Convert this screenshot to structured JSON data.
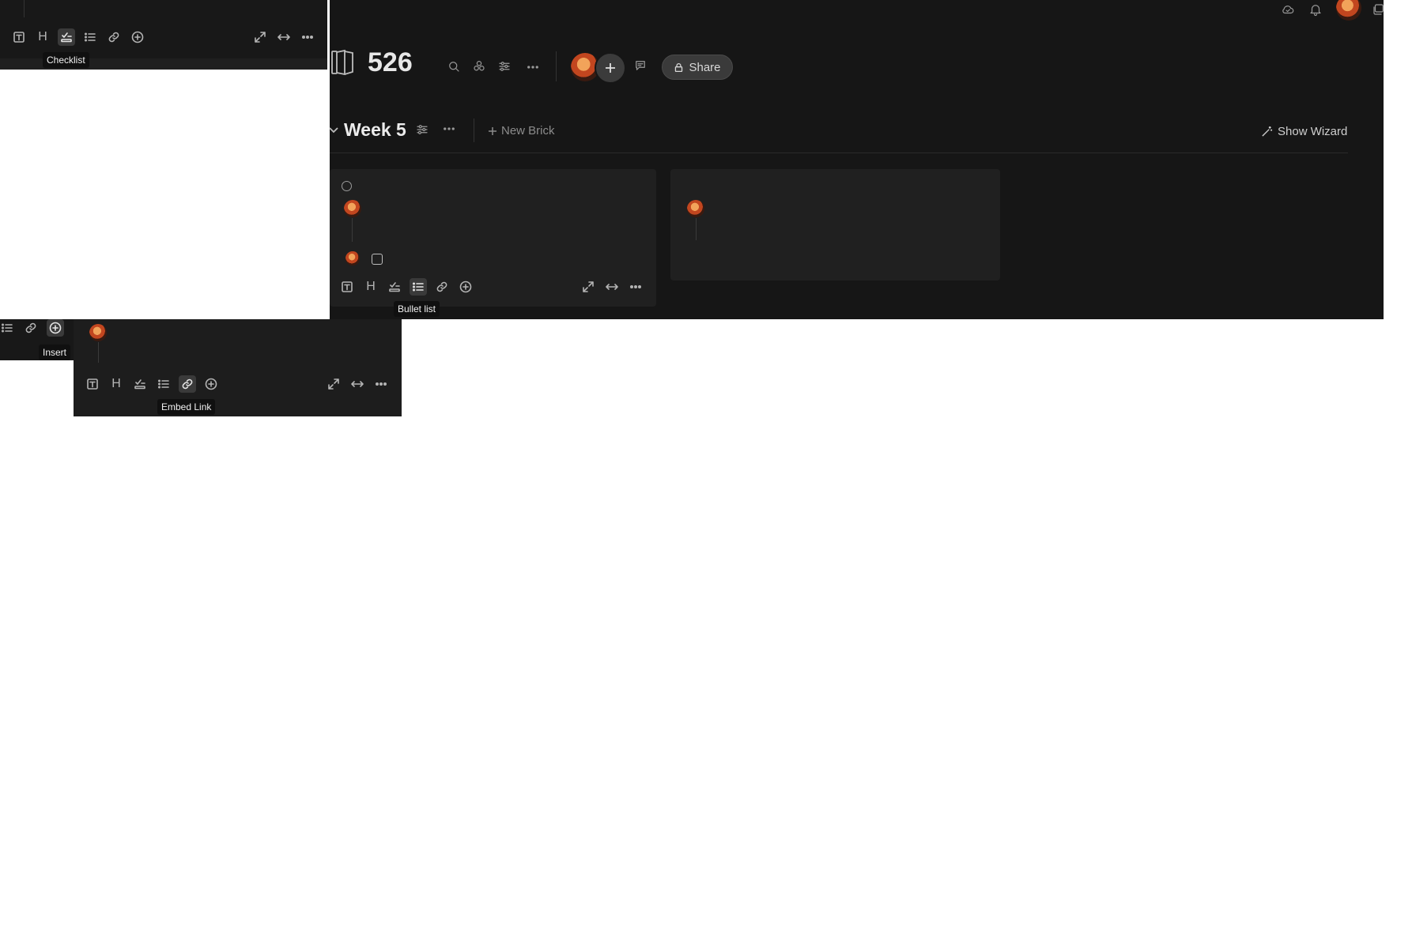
{
  "board": {
    "title": "526",
    "share_label": "Share"
  },
  "section": {
    "title": "Week 5",
    "new_brick_label": "New Brick",
    "show_wizard_label": "Show Wizard"
  },
  "toolbar": {
    "text": "T",
    "heading": "H"
  },
  "tooltips": {
    "checklist": "Checklist",
    "bullet_list": "Bullet list",
    "insert": "Insert",
    "embed_link": "Embed Link"
  },
  "icons": [
    "cloud-icon",
    "bell-icon",
    "avatar",
    "windows-icon",
    "board-icon",
    "search-icon",
    "apps-icon",
    "sliders-icon",
    "more-icon",
    "add-member-icon",
    "comments-icon",
    "lock-icon",
    "chevron-down-icon",
    "plus-icon",
    "wand-icon",
    "text-icon",
    "heading-icon",
    "checklist-icon",
    "bullet-list-icon",
    "link-icon",
    "insert-icon",
    "expand-icon",
    "width-icon"
  ],
  "colors": {
    "background": "#161616",
    "panel": "#1d1d1d",
    "card": "#202020",
    "text": "#e8e8e8",
    "muted": "#9a9a9a"
  }
}
